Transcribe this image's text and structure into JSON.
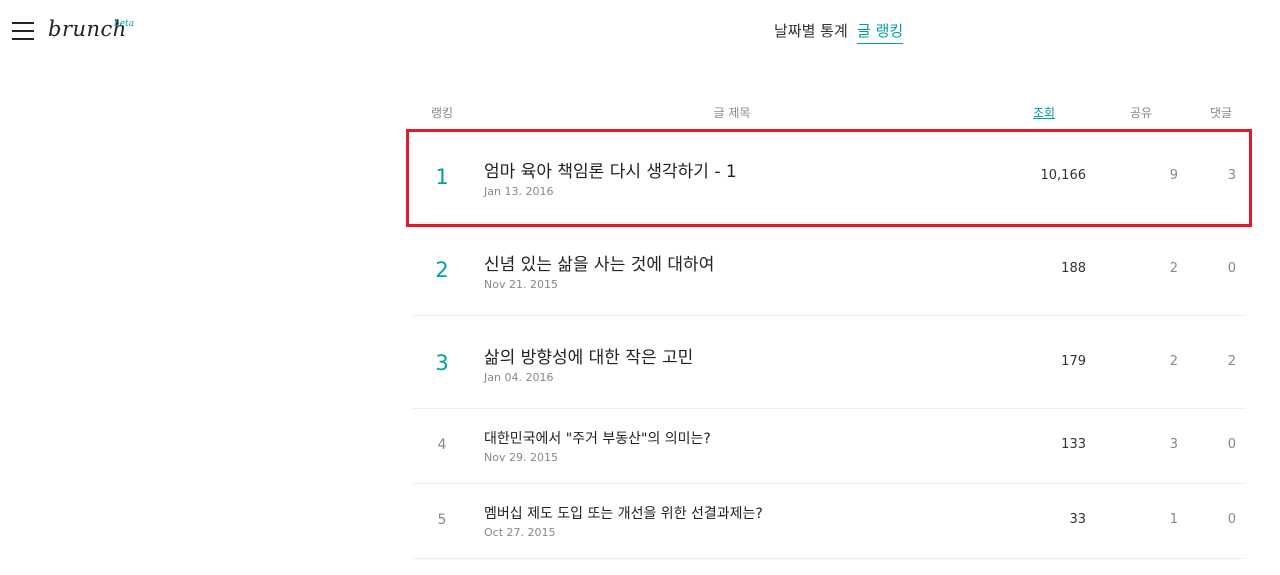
{
  "app": {
    "logo_text": "brunch",
    "logo_badge": "beta"
  },
  "header": {
    "tabs": [
      {
        "label": "날짜별 통계",
        "active": false
      },
      {
        "label": "글 랭킹",
        "active": true
      }
    ]
  },
  "table": {
    "columns": {
      "rank": "랭킹",
      "title": "글 제목",
      "views": "조회",
      "shares": "공유",
      "comments": "댓글"
    },
    "sort_column": "views",
    "rows": [
      {
        "rank": "1",
        "title": "엄마 육아 책임론 다시 생각하기 - 1",
        "date": "Jan 13. 2016",
        "views": "10,166",
        "shares": "9",
        "comments": "3"
      },
      {
        "rank": "2",
        "title": "신념 있는 삶을 사는 것에 대하여",
        "date": "Nov 21. 2015",
        "views": "188",
        "shares": "2",
        "comments": "0"
      },
      {
        "rank": "3",
        "title": "삶의 방향성에 대한 작은 고민",
        "date": "Jan 04. 2016",
        "views": "179",
        "shares": "2",
        "comments": "2"
      },
      {
        "rank": "4",
        "title": "대한민국에서 \"주거 부동산\"의 의미는?",
        "date": "Nov 29. 2015",
        "views": "133",
        "shares": "3",
        "comments": "0"
      },
      {
        "rank": "5",
        "title": "멤버십 제도 도입 또는 개선을 위한 선결과제는?",
        "date": "Oct 27. 2015",
        "views": "33",
        "shares": "1",
        "comments": "0"
      }
    ]
  },
  "colors": {
    "accent": "#00a0a0",
    "highlight": "#e21b2a"
  }
}
